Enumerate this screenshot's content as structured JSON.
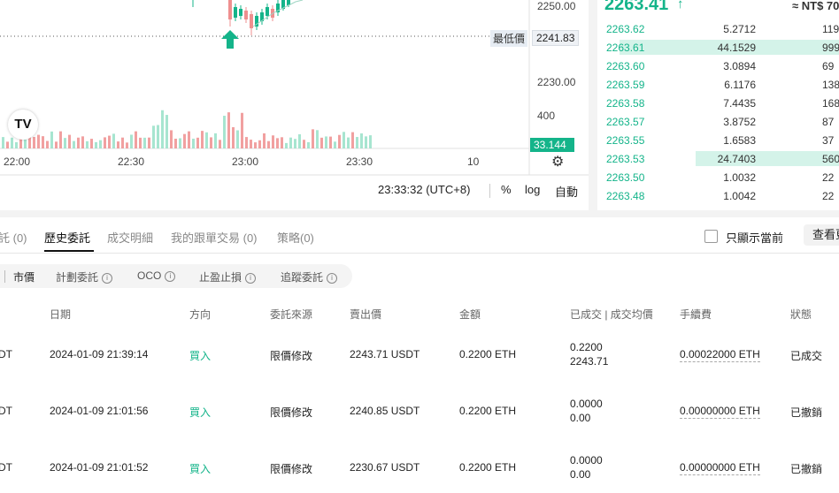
{
  "chart": {
    "price_axis": [
      "2250.00",
      "2230.00",
      "400"
    ],
    "low_label": "最低價",
    "low_value": "2241.83",
    "volume_badge": "33.144",
    "time_axis": [
      "22:00",
      "22:30",
      "23:00",
      "23:30",
      "10"
    ],
    "clock": "23:33:32 (UTC+8)",
    "tools": {
      "percent": "%",
      "log": "log",
      "auto": "自動"
    },
    "logo_text": "TV"
  },
  "orderbook": {
    "last_price": "2263.41",
    "arrow": "↑",
    "fiat": "≈ NT$ 70",
    "rows": [
      {
        "price": "2263.62",
        "qty": "5.2712",
        "total": "119"
      },
      {
        "price": "2263.61",
        "qty": "44.1529",
        "total": "999"
      },
      {
        "price": "2263.60",
        "qty": "3.0894",
        "total": "69"
      },
      {
        "price": "2263.59",
        "qty": "6.1176",
        "total": "138"
      },
      {
        "price": "2263.58",
        "qty": "7.4435",
        "total": "168"
      },
      {
        "price": "2263.57",
        "qty": "3.8752",
        "total": "87"
      },
      {
        "price": "2263.55",
        "qty": "1.6583",
        "total": "37"
      },
      {
        "price": "2263.53",
        "qty": "24.7403",
        "total": "560"
      },
      {
        "price": "2263.50",
        "qty": "1.0032",
        "total": "22"
      },
      {
        "price": "2263.48",
        "qty": "1.0042",
        "total": "22"
      }
    ]
  },
  "orders": {
    "tabs": [
      "託 (0)",
      "歷史委託",
      "成交明細",
      "我的跟單交易 (0)",
      "策略(0)"
    ],
    "only_current": "只顯示當前",
    "view_all": "查看更",
    "filters": [
      "市價",
      "計劃委託",
      "OCO",
      "止盈止損",
      "追蹤委託"
    ],
    "columns": [
      "日期",
      "方向",
      "委託來源",
      "賣出價",
      "金額",
      "已成交 | 成交均價",
      "手續費",
      "狀態"
    ],
    "rows": [
      {
        "pair_tail": "DT",
        "date": "2024-01-09 21:39:14",
        "side": "買入",
        "source": "限價修改",
        "price": "2243.71 USDT",
        "amount": "0.2200 ETH",
        "filled": "0.2200",
        "avg": "2243.71",
        "fee": "0.00022000 ETH",
        "status": "已成交"
      },
      {
        "pair_tail": "DT",
        "date": "2024-01-09 21:01:56",
        "side": "買入",
        "source": "限價修改",
        "price": "2240.85 USDT",
        "amount": "0.2200 ETH",
        "filled": "0.0000",
        "avg": "0.00",
        "fee": "0.00000000 ETH",
        "status": "已撤銷"
      },
      {
        "pair_tail": "DT",
        "date": "2024-01-09 21:01:52",
        "side": "買入",
        "source": "限價修改",
        "price": "2230.67 USDT",
        "amount": "0.2200 ETH",
        "filled": "0.0000",
        "avg": "0.00",
        "fee": "0.00000000 ETH",
        "status": "已撤銷"
      }
    ]
  },
  "colors": {
    "up": "#14b48a",
    "down": "#ef8f8f",
    "up_volume": "#98e0c8"
  }
}
